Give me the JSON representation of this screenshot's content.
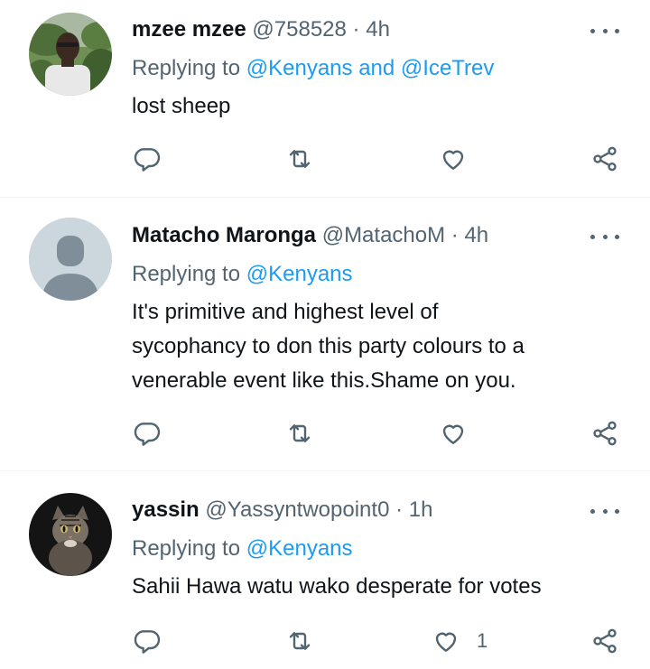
{
  "tweets": [
    {
      "name": "mzee mzee",
      "handle": "@758528",
      "sep": "·",
      "time": "4h",
      "replying_prefix": "Replying to",
      "mentions": [
        "@Kenyans",
        "@IceTrev"
      ],
      "mentions_joiner": "and",
      "text_lines": [
        "lost sheep"
      ],
      "like_count": ""
    },
    {
      "name": "Matacho Maronga",
      "handle": "@MatachoM",
      "sep": "·",
      "time": "4h",
      "replying_prefix": "Replying to",
      "mentions": [
        "@Kenyans"
      ],
      "text_lines": [
        "It's primitive and  highest level of",
        "sycophancy to don this party colours to a",
        "venerable event like this.Shame on you."
      ],
      "like_count": ""
    },
    {
      "name": "yassin",
      "handle": "@Yassyntwopoint0",
      "sep": "·",
      "time": "1h",
      "replying_prefix": "Replying to",
      "mentions": [
        "@Kenyans"
      ],
      "text_lines": [
        "Sahii Hawa watu wako desperate for votes"
      ],
      "like_count": "1"
    }
  ],
  "icons": {
    "reply": "reply-icon",
    "retweet": "retweet-icon",
    "like": "like-icon",
    "share": "share-icon",
    "more": "more-icon"
  },
  "colors": {
    "text": "#0f1419",
    "secondary": "#536471",
    "mention": "#1d9bf0",
    "divider": "#eff3f4"
  }
}
